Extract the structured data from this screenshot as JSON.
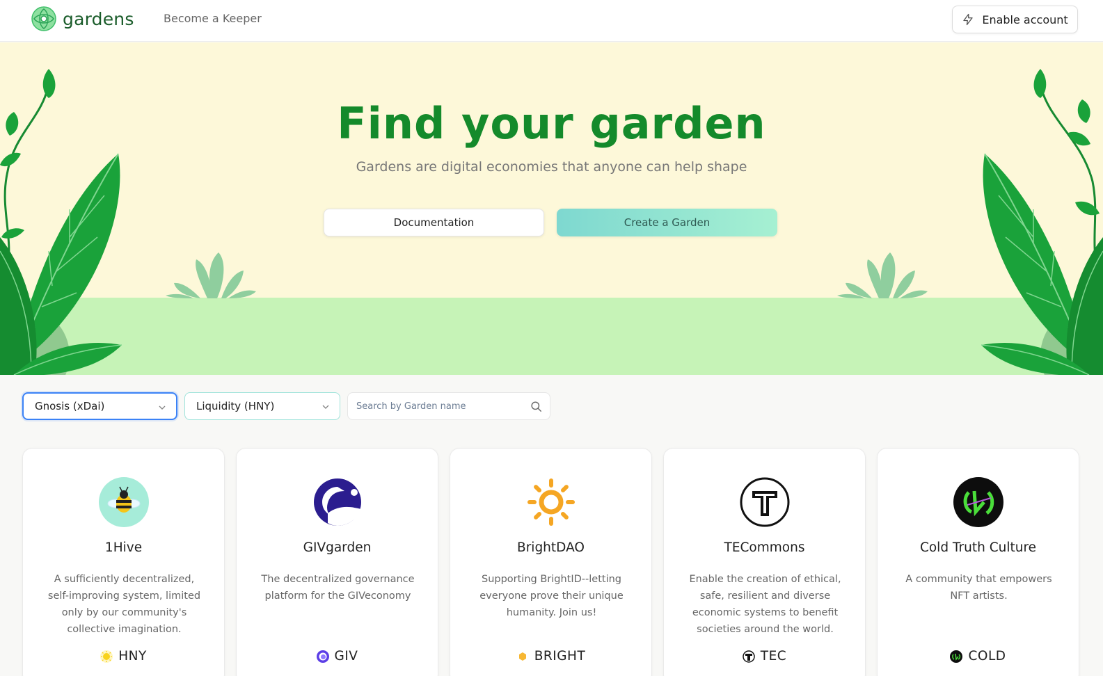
{
  "header": {
    "logo_text": "gardens",
    "nav_keeper": "Become a Keeper",
    "enable_account": "Enable account"
  },
  "hero": {
    "title": "Find your garden",
    "subtitle": "Gardens are digital economies that anyone can help shape",
    "documentation_button": "Documentation",
    "create_button": "Create a Garden"
  },
  "filters": {
    "network_selected": "Gnosis (xDai)",
    "sort_selected": "Liquidity (HNY)",
    "search_placeholder": "Search by Garden name",
    "search_value": ""
  },
  "gardens": [
    {
      "name": "1Hive",
      "description": "A sufficiently decentralized, self-improving system, limited only by our community's collective imagination.",
      "token": "HNY",
      "icon": "bee-icon"
    },
    {
      "name": "GIVgarden",
      "description": "The decentralized governance platform for the GIVeconomy",
      "token": "GIV",
      "icon": "giv-icon"
    },
    {
      "name": "BrightDAO",
      "description": "Supporting BrightID--letting everyone prove their unique humanity. Join us!",
      "token": "BRIGHT",
      "icon": "sun-icon"
    },
    {
      "name": "TECommons",
      "description": "Enable the creation of ethical, safe, resilient and diverse economic systems to benefit societies around the world.",
      "token": "TEC",
      "icon": "tec-icon"
    },
    {
      "name": "Cold Truth Culture",
      "description": "A community that empowers NFT artists.",
      "token": "COLD",
      "icon": "cold-icon"
    }
  ],
  "colors": {
    "brand_green": "#148a2b",
    "hero_bg": "#fdf8d9",
    "ground": "#c6f3b7",
    "leaf": "#1aa23a",
    "create_button_gradient_start": "#7ed8d0",
    "create_button_gradient_end": "#a6f0d2",
    "focus_blue": "#3b82f6"
  }
}
